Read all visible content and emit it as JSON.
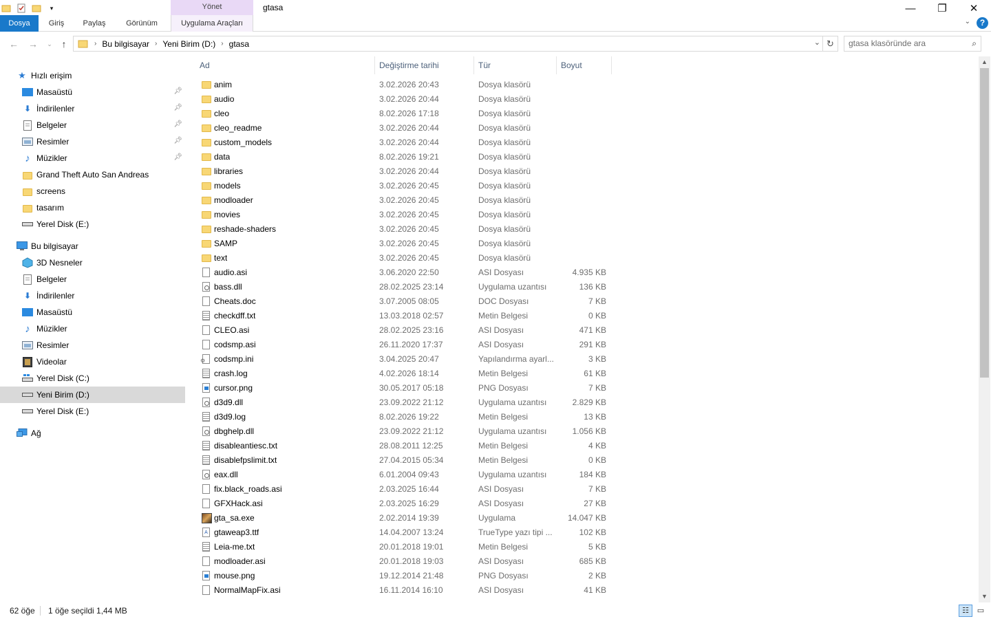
{
  "window": {
    "title": "gtasa",
    "context_tab_group": "Yönet"
  },
  "ribbon": {
    "tabs": [
      "Dosya",
      "Giriş",
      "Paylaş",
      "Görünüm",
      "Uygulama Araçları"
    ],
    "help": "?"
  },
  "address": {
    "crumbs": [
      "Bu bilgisayar",
      "Yeni Birim (D:)",
      "gtasa"
    ],
    "search_placeholder": "gtasa klasöründe ara"
  },
  "nav": {
    "quick_access": "Hızlı erişim",
    "quick_items": [
      "Masaüstü",
      "İndirilenler",
      "Belgeler",
      "Resimler",
      "Müzikler",
      "Grand Theft Auto  San Andreas",
      "screens",
      "tasarım",
      "Yerel Disk (E:)"
    ],
    "this_pc": "Bu bilgisayar",
    "pc_items": [
      "3D Nesneler",
      "Belgeler",
      "İndirilenler",
      "Masaüstü",
      "Müzikler",
      "Resimler",
      "Videolar",
      "Yerel Disk (C:)",
      "Yeni Birim (D:)",
      "Yerel Disk (E:)"
    ],
    "network": "Ağ",
    "selected": "Yeni Birim (D:)"
  },
  "columns": [
    "Ad",
    "Değiştirme tarihi",
    "Tür",
    "Boyut"
  ],
  "files": [
    {
      "name": "anim",
      "date": "3.02.2026 20:43",
      "type": "Dosya klasörü",
      "size": "",
      "icon": "folder"
    },
    {
      "name": "audio",
      "date": "3.02.2026 20:44",
      "type": "Dosya klasörü",
      "size": "",
      "icon": "folder"
    },
    {
      "name": "cleo",
      "date": "8.02.2026 17:18",
      "type": "Dosya klasörü",
      "size": "",
      "icon": "folder"
    },
    {
      "name": "cleo_readme",
      "date": "3.02.2026 20:44",
      "type": "Dosya klasörü",
      "size": "",
      "icon": "folder"
    },
    {
      "name": "custom_models",
      "date": "3.02.2026 20:44",
      "type": "Dosya klasörü",
      "size": "",
      "icon": "folder"
    },
    {
      "name": "data",
      "date": "8.02.2026 19:21",
      "type": "Dosya klasörü",
      "size": "",
      "icon": "folder"
    },
    {
      "name": "libraries",
      "date": "3.02.2026 20:44",
      "type": "Dosya klasörü",
      "size": "",
      "icon": "folder"
    },
    {
      "name": "models",
      "date": "3.02.2026 20:45",
      "type": "Dosya klasörü",
      "size": "",
      "icon": "folder"
    },
    {
      "name": "modloader",
      "date": "3.02.2026 20:45",
      "type": "Dosya klasörü",
      "size": "",
      "icon": "folder"
    },
    {
      "name": "movies",
      "date": "3.02.2026 20:45",
      "type": "Dosya klasörü",
      "size": "",
      "icon": "folder"
    },
    {
      "name": "reshade-shaders",
      "date": "3.02.2026 20:45",
      "type": "Dosya klasörü",
      "size": "",
      "icon": "folder"
    },
    {
      "name": "SAMP",
      "date": "3.02.2026 20:45",
      "type": "Dosya klasörü",
      "size": "",
      "icon": "folder"
    },
    {
      "name": "text",
      "date": "3.02.2026 20:45",
      "type": "Dosya klasörü",
      "size": "",
      "icon": "folder"
    },
    {
      "name": "audio.asi",
      "date": "3.06.2020 22:50",
      "type": "ASI Dosyası",
      "size": "4.935 KB",
      "icon": "file"
    },
    {
      "name": "bass.dll",
      "date": "28.02.2025 23:14",
      "type": "Uygulama uzantısı",
      "size": "136 KB",
      "icon": "dll"
    },
    {
      "name": "Cheats.doc",
      "date": "3.07.2005 08:05",
      "type": "DOC Dosyası",
      "size": "7 KB",
      "icon": "file"
    },
    {
      "name": "checkdff.txt",
      "date": "13.03.2018 02:57",
      "type": "Metin Belgesi",
      "size": "0 KB",
      "icon": "txt"
    },
    {
      "name": "CLEO.asi",
      "date": "28.02.2025 23:16",
      "type": "ASI Dosyası",
      "size": "471 KB",
      "icon": "file"
    },
    {
      "name": "codsmp.asi",
      "date": "26.11.2020 17:37",
      "type": "ASI Dosyası",
      "size": "291 KB",
      "icon": "file"
    },
    {
      "name": "codsmp.ini",
      "date": "3.04.2025 20:47",
      "type": "Yapılandırma ayarl...",
      "size": "3 KB",
      "icon": "ini"
    },
    {
      "name": "crash.log",
      "date": "4.02.2026 18:14",
      "type": "Metin Belgesi",
      "size": "61 KB",
      "icon": "txt"
    },
    {
      "name": "cursor.png",
      "date": "30.05.2017 05:18",
      "type": "PNG Dosyası",
      "size": "7 KB",
      "icon": "png"
    },
    {
      "name": "d3d9.dll",
      "date": "23.09.2022 21:12",
      "type": "Uygulama uzantısı",
      "size": "2.829 KB",
      "icon": "dll"
    },
    {
      "name": "d3d9.log",
      "date": "8.02.2026 19:22",
      "type": "Metin Belgesi",
      "size": "13 KB",
      "icon": "txt"
    },
    {
      "name": "dbghelp.dll",
      "date": "23.09.2022 21:12",
      "type": "Uygulama uzantısı",
      "size": "1.056 KB",
      "icon": "dll"
    },
    {
      "name": "disableantiesc.txt",
      "date": "28.08.2011 12:25",
      "type": "Metin Belgesi",
      "size": "4 KB",
      "icon": "txt"
    },
    {
      "name": "disablefpslimit.txt",
      "date": "27.04.2015 05:34",
      "type": "Metin Belgesi",
      "size": "0 KB",
      "icon": "txt"
    },
    {
      "name": "eax.dll",
      "date": "6.01.2004 09:43",
      "type": "Uygulama uzantısı",
      "size": "184 KB",
      "icon": "dll"
    },
    {
      "name": "fix.black_roads.asi",
      "date": "2.03.2025 16:44",
      "type": "ASI Dosyası",
      "size": "7 KB",
      "icon": "file"
    },
    {
      "name": "GFXHack.asi",
      "date": "2.03.2025 16:29",
      "type": "ASI Dosyası",
      "size": "27 KB",
      "icon": "file"
    },
    {
      "name": "gta_sa.exe",
      "date": "2.02.2014 19:39",
      "type": "Uygulama",
      "size": "14.047 KB",
      "icon": "exe"
    },
    {
      "name": "gtaweap3.ttf",
      "date": "14.04.2007 13:24",
      "type": "TrueType yazı tipi ...",
      "size": "102 KB",
      "icon": "ttf"
    },
    {
      "name": "Leia-me.txt",
      "date": "20.01.2018 19:01",
      "type": "Metin Belgesi",
      "size": "5 KB",
      "icon": "txt"
    },
    {
      "name": "modloader.asi",
      "date": "20.01.2018 19:03",
      "type": "ASI Dosyası",
      "size": "685 KB",
      "icon": "file"
    },
    {
      "name": "mouse.png",
      "date": "19.12.2014 21:48",
      "type": "PNG Dosyası",
      "size": "2 KB",
      "icon": "png"
    },
    {
      "name": "NormalMapFix.asi",
      "date": "16.11.2014 16:10",
      "type": "ASI Dosyası",
      "size": "41 KB",
      "icon": "file"
    }
  ],
  "status": {
    "count": "62 öğe",
    "selection": "1 öğe seçildi  1,44 MB"
  }
}
